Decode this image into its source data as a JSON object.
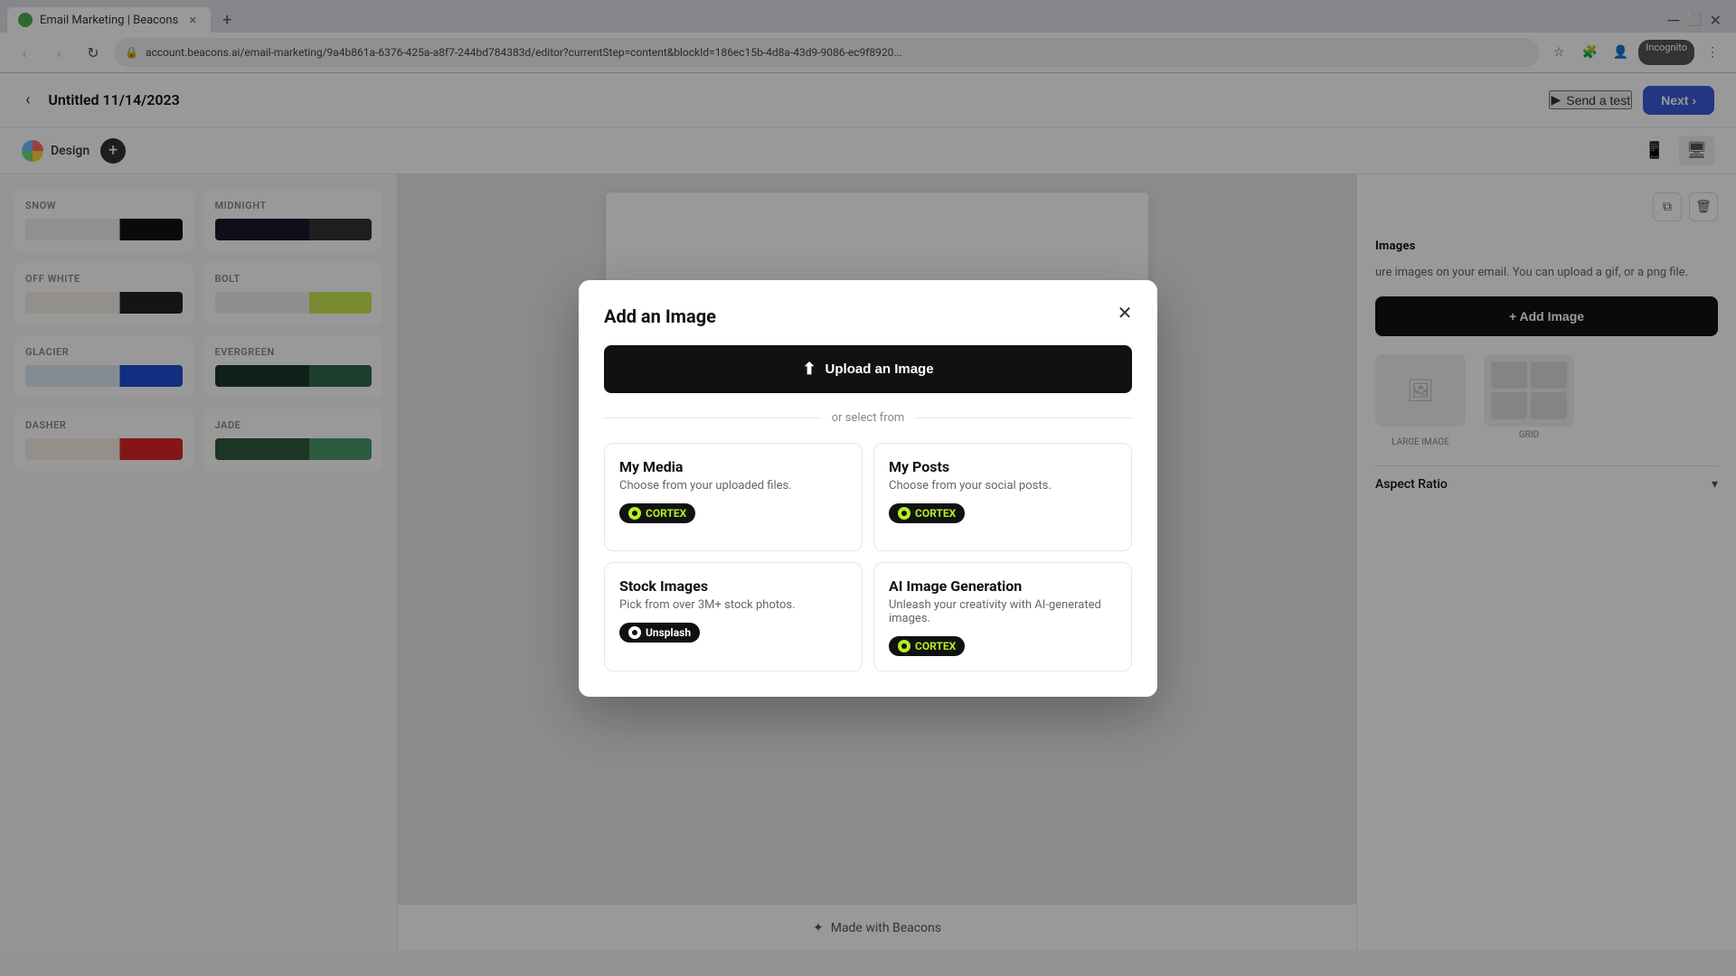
{
  "browser": {
    "tab_title": "Email Marketing | Beacons",
    "address": "account.beacons.ai/email-marketing/9a4b861a-6376-425a-a8f7-244bd784383d/editor?currentStep=content&blockId=186ec15b-4d8a-43d9-9086-ec9f8920...",
    "incognito_label": "Incognito"
  },
  "header": {
    "back_label": "‹",
    "page_title": "Untitled 11/14/2023",
    "send_test_label": "Send a test",
    "next_label": "Next ›"
  },
  "sub_header": {
    "design_label": "Design",
    "add_label": "+"
  },
  "themes": [
    {
      "id": "snow",
      "name": "SNOW",
      "class": "snow"
    },
    {
      "id": "midnight",
      "name": "MIDNIGHT",
      "class": "midnight"
    },
    {
      "id": "off-white",
      "name": "OFF WHITE",
      "class": "off-white"
    },
    {
      "id": "bolt",
      "name": "BOLT",
      "class": "bolt"
    },
    {
      "id": "glacier",
      "name": "GLACIER",
      "class": "glacier"
    },
    {
      "id": "evergreen",
      "name": "EVERGREEN",
      "class": "evergreen"
    },
    {
      "id": "dasher",
      "name": "DASHER",
      "class": "dasher"
    },
    {
      "id": "jade",
      "name": "JADE",
      "class": "jade"
    }
  ],
  "right_panel": {
    "images_title": "Images",
    "description": "ure images on your email. You can upload a gif, or a png file.",
    "add_image_label": "+ Add Image",
    "large_image_label": "LARGE IMAGE",
    "grid_label": "GRID",
    "aspect_ratio_label": "Aspect Ratio"
  },
  "footer": {
    "made_with_label": "Made with Beacons"
  },
  "modal": {
    "title": "Add an Image",
    "upload_label": "Upload an Image",
    "divider_label": "or select from",
    "close_label": "✕",
    "sources": [
      {
        "id": "my-media",
        "title": "My Media",
        "desc": "Choose from your uploaded files.",
        "badge_type": "cortex",
        "badge_label": "CORTEX"
      },
      {
        "id": "my-posts",
        "title": "My Posts",
        "desc": "Choose from your social posts.",
        "badge_type": "cortex",
        "badge_label": "CORTEX"
      },
      {
        "id": "stock-images",
        "title": "Stock Images",
        "desc": "Pick from over 3M+ stock photos.",
        "badge_type": "unsplash",
        "badge_label": "Unsplash"
      },
      {
        "id": "ai-generation",
        "title": "AI Image Generation",
        "desc": "Unleash your creativity with AI-generated images.",
        "badge_type": "cortex",
        "badge_label": "CORTEX"
      }
    ]
  }
}
